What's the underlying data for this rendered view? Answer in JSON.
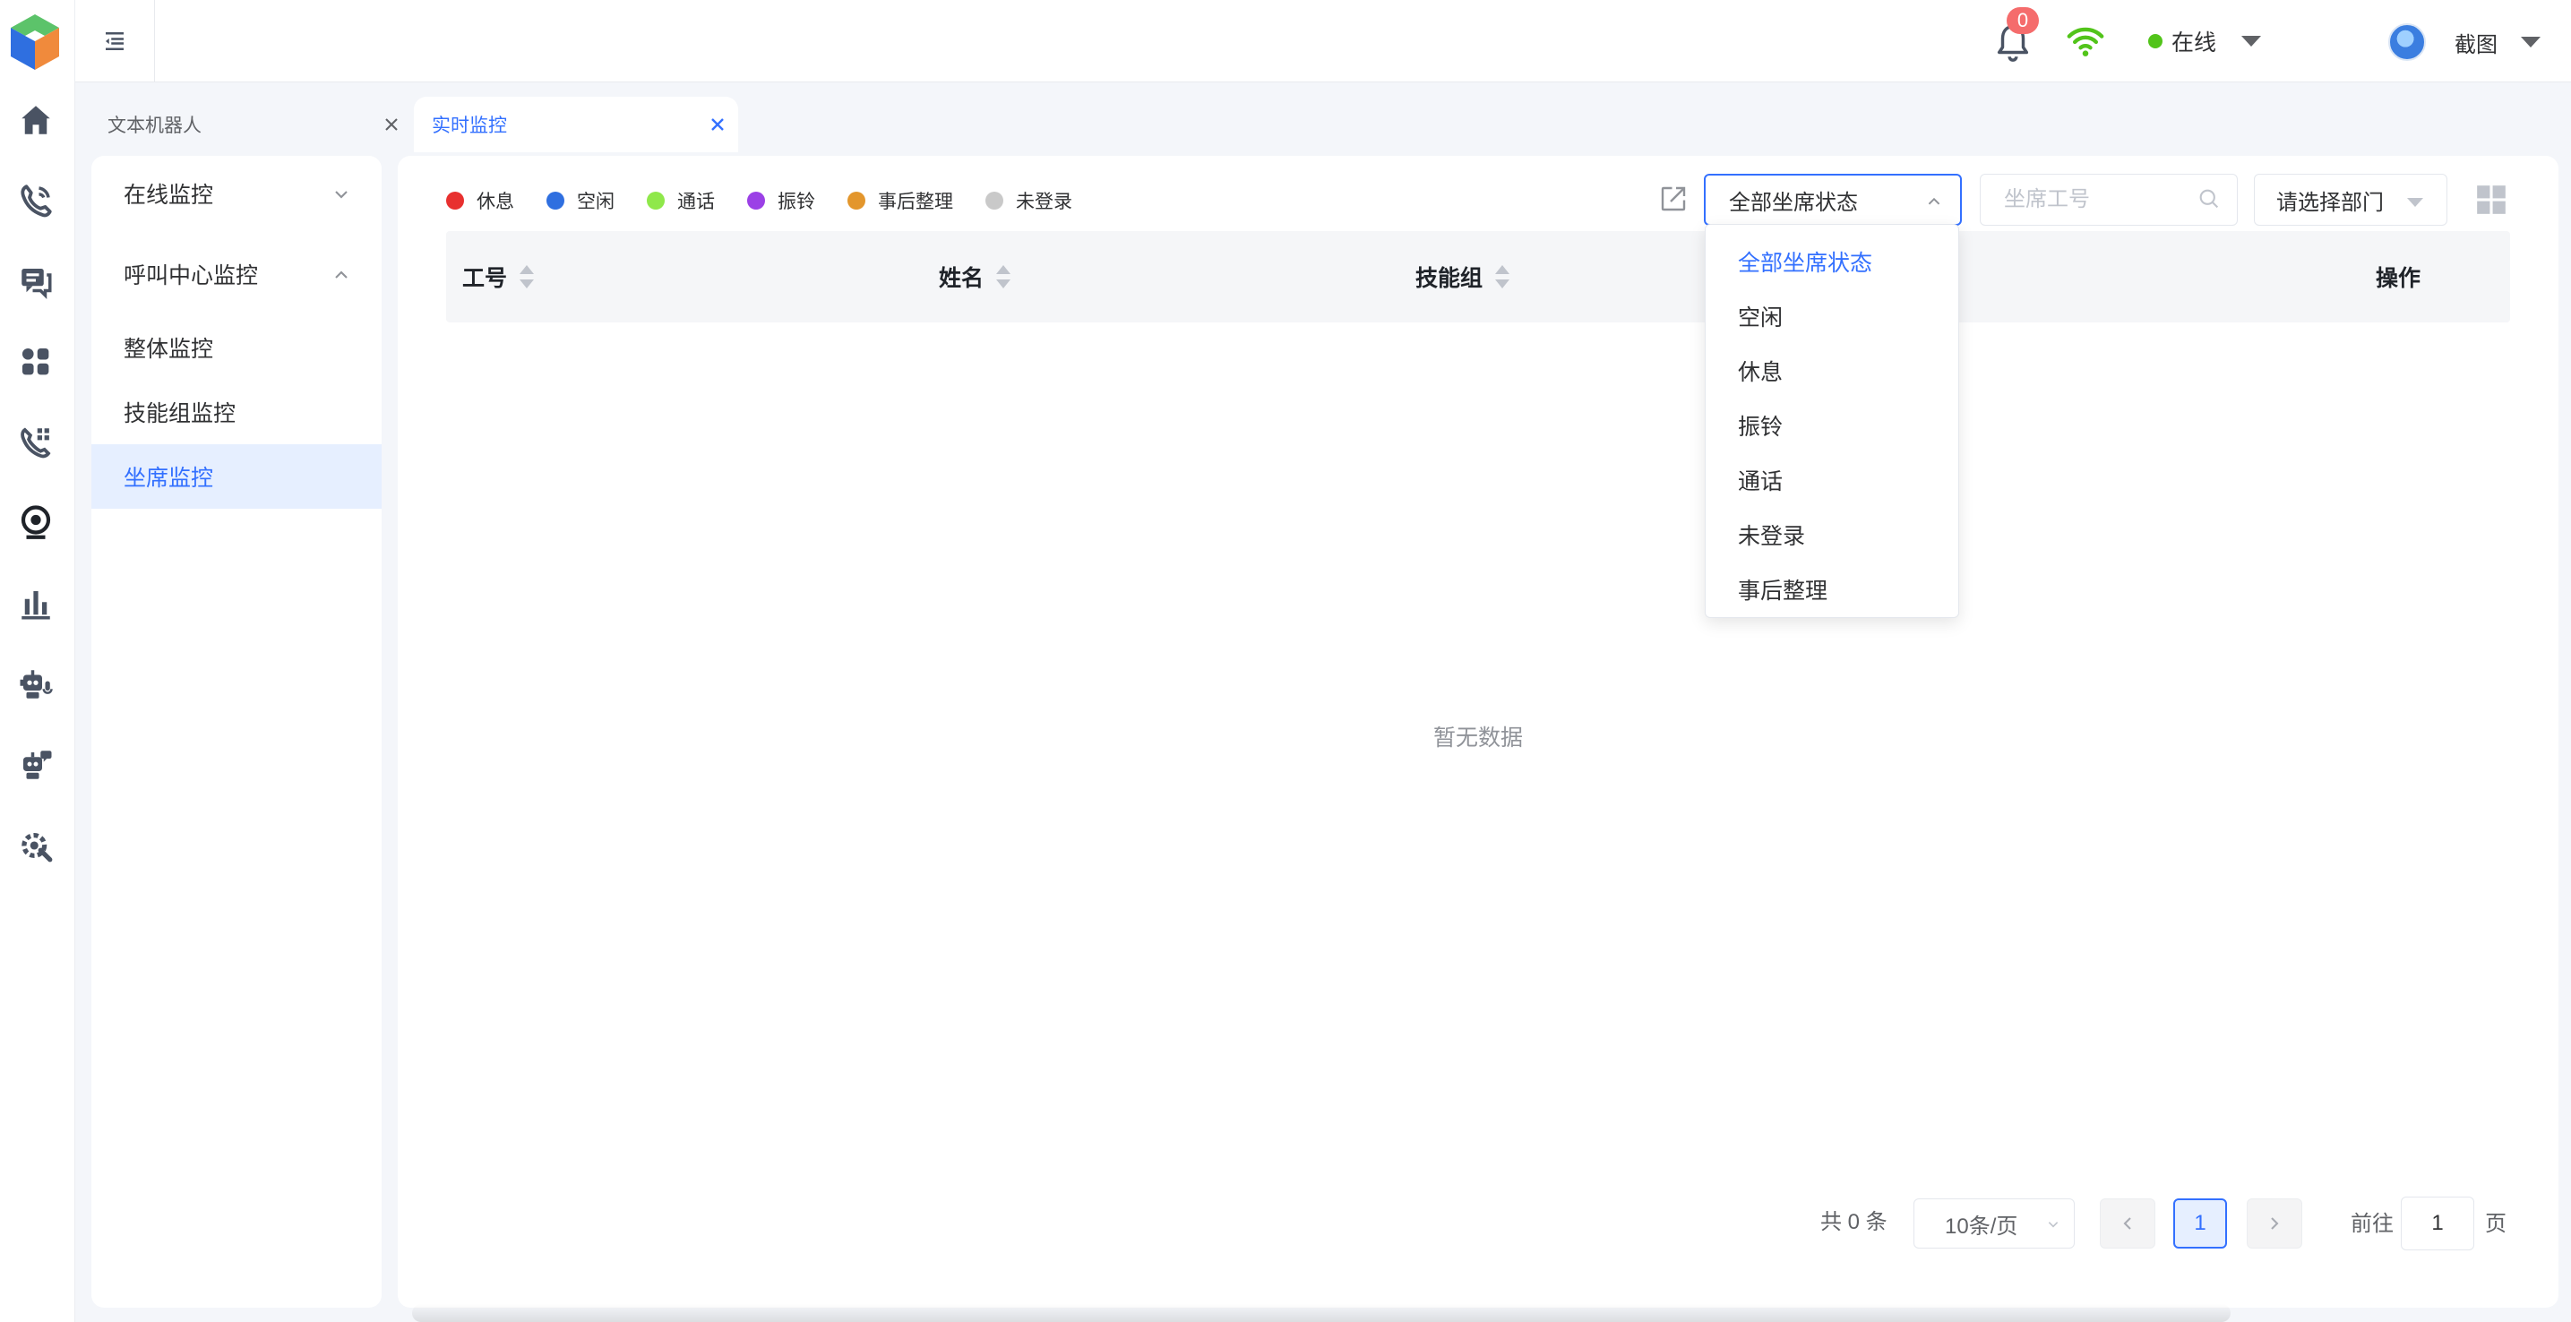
{
  "header": {
    "notification_count": "0",
    "status_label": "在线",
    "user_name": "截图"
  },
  "tabs": [
    {
      "label": "文本机器人",
      "active": false
    },
    {
      "label": "实时监控",
      "active": true
    }
  ],
  "sidemenu": {
    "groups": [
      {
        "label": "在线监控",
        "expanded": false
      },
      {
        "label": "呼叫中心监控",
        "expanded": true
      }
    ],
    "items": [
      {
        "label": "整体监控",
        "active": false
      },
      {
        "label": "技能组监控",
        "active": false
      },
      {
        "label": "坐席监控",
        "active": true
      }
    ]
  },
  "legend": [
    {
      "label": "休息",
      "color": "#e8302f"
    },
    {
      "label": "空闲",
      "color": "#2f6fe0"
    },
    {
      "label": "通话",
      "color": "#8fe84a"
    },
    {
      "label": "振铃",
      "color": "#9b40e6"
    },
    {
      "label": "事后整理",
      "color": "#e3962c"
    },
    {
      "label": "未登录",
      "color": "#c9c9c9"
    }
  ],
  "filters": {
    "status_select_value": "全部坐席状态",
    "search_placeholder": "坐席工号",
    "dept_select_placeholder": "请选择部门"
  },
  "table": {
    "columns": [
      "工号",
      "姓名",
      "技能组",
      "操作"
    ],
    "empty_text": "暂无数据"
  },
  "dropdown": {
    "options": [
      "全部坐席状态",
      "空闲",
      "休息",
      "振铃",
      "通话",
      "未登录",
      "事后整理"
    ],
    "selected_index": 0
  },
  "pagination": {
    "total_text": "共 0 条",
    "page_size": "10条/页",
    "current_page": "1",
    "goto_label": "前往",
    "goto_value": "1",
    "goto_suffix": "页"
  },
  "colors": {
    "accent": "#3370ff",
    "online": "#52c41a",
    "badge": "#f56c6c"
  }
}
